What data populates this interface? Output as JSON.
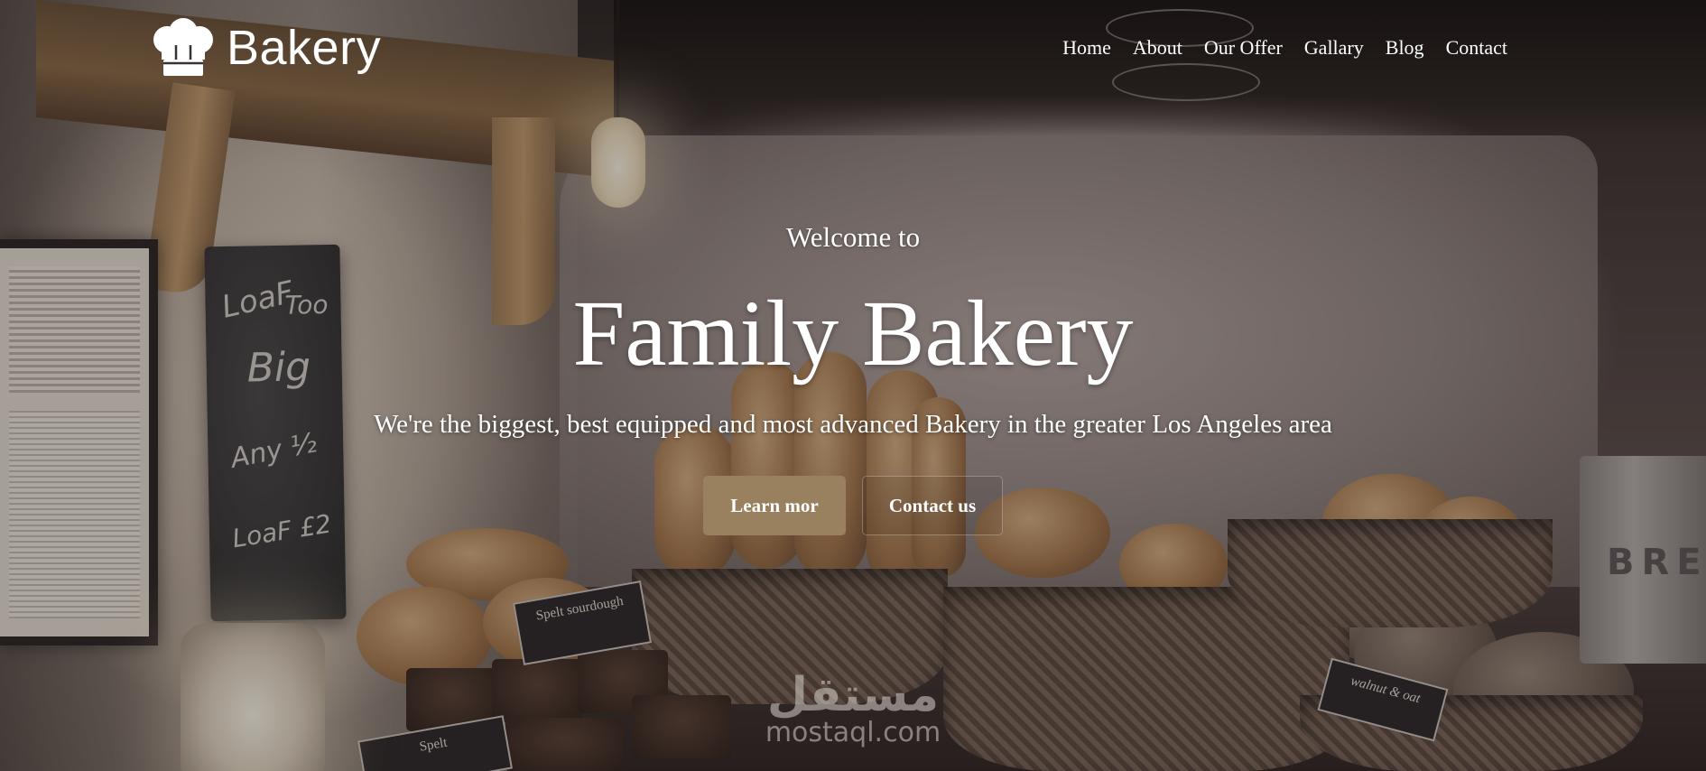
{
  "brand": {
    "name": "Bakery",
    "icon": "chef-hat-icon"
  },
  "nav": {
    "items": [
      {
        "label": "Home"
      },
      {
        "label": "About"
      },
      {
        "label": "Our Offer"
      },
      {
        "label": "Gallary"
      },
      {
        "label": "Blog"
      },
      {
        "label": "Contact"
      }
    ]
  },
  "hero": {
    "welcome": "Welcome to",
    "title": "Family Bakery",
    "subtitle": "We're the biggest, best equipped and most advanced Bakery in the greater Los Angeles area",
    "primary_button": "Learn mor",
    "secondary_button": "Contact us"
  },
  "scene": {
    "chalkboard": [
      "LoaF",
      "Too",
      "Big",
      "Any ½",
      "LoaF £2"
    ],
    "tags": [
      "Spelt sourdough",
      "Spelt",
      "walnut & oat"
    ],
    "bin_label": "BRE"
  },
  "watermark": {
    "arabic": "مستقل",
    "latin": "mostaql.com"
  },
  "colors": {
    "accent": "#99805f",
    "text": "#ffffff"
  }
}
